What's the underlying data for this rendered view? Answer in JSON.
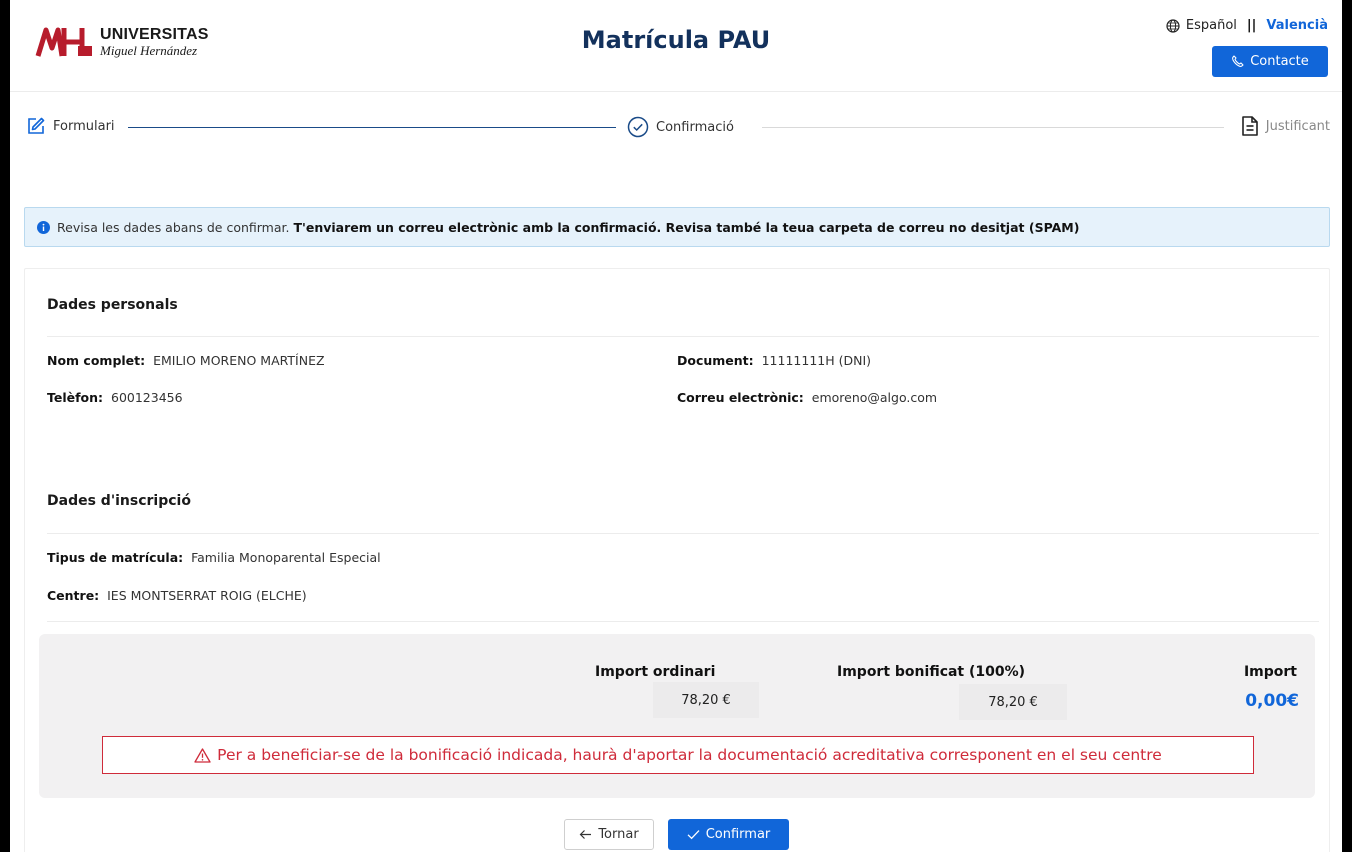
{
  "header": {
    "logo_title": "UNIVERSITAS",
    "logo_subtitle": "Miguel Hernández",
    "page_title": "Matrícula PAU",
    "lang_es": "Español",
    "lang_separator": "||",
    "lang_va": "Valencià",
    "contact_label": "Contacte"
  },
  "stepper": {
    "steps": [
      {
        "label": "Formulari",
        "state": "done",
        "icon": "edit-icon"
      },
      {
        "label": "Confirmació",
        "state": "current",
        "icon": "check-circle-icon"
      },
      {
        "label": "Justificant",
        "state": "pending",
        "icon": "document-icon"
      }
    ]
  },
  "alert": {
    "text": "Revisa les dades abans de confirmar.",
    "bold": "T'enviarem un correu electrònic amb la confirmació. Revisa també la teua carpeta de correu no desitjat (SPAM)"
  },
  "personal": {
    "title": "Dades personals",
    "name_label": "Nom complet",
    "name_value": "EMILIO MORENO MARTÍNEZ",
    "doc_label": "Document",
    "doc_value": "11111111H (DNI)",
    "phone_label": "Telèfon",
    "phone_value": "600123456",
    "email_label": "Correu electrònic",
    "email_value": "emoreno@algo.com"
  },
  "enrollment": {
    "title": "Dades d'inscripció",
    "type_label": "Tipus de matrícula",
    "type_value": "Familia Monoparental Especial",
    "centre_label": "Centre",
    "centre_value": "IES MONTSERRAT ROIG (ELCHE)"
  },
  "amounts": {
    "ordinary_label": "Import ordinari",
    "ordinary_value": "78,20 €",
    "discount_label": "Import bonificat (100%)",
    "discount_value": "78,20 €",
    "total_label": "Import",
    "total_value": "0,00€",
    "warning": "Per a beneficiar-se de la bonificació indicada, haurà d'aportar la documentació acreditativa corresponent en el seu centre"
  },
  "actions": {
    "back_label": "Tornar",
    "confirm_label": "Confirmar"
  },
  "colors": {
    "primary": "#1166d9",
    "title": "#13315c",
    "danger": "#cf2b3a"
  }
}
